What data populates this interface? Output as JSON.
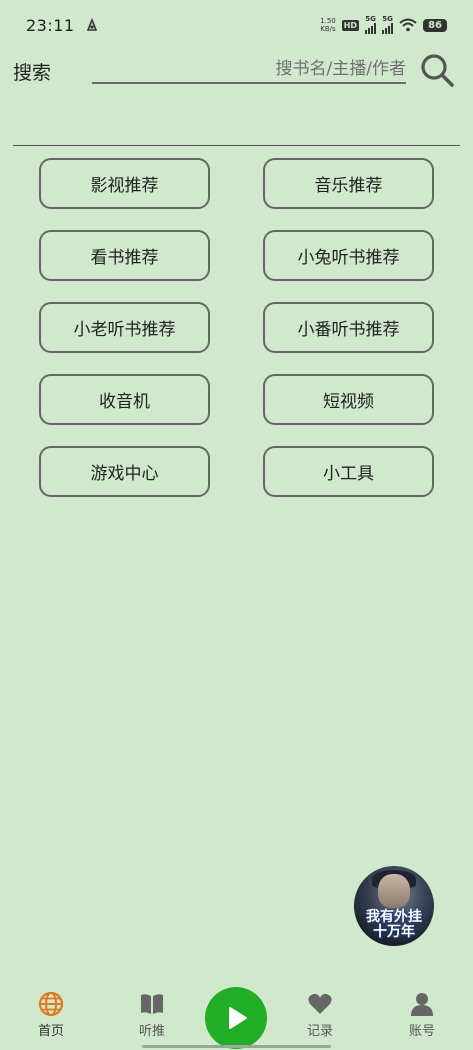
{
  "status_bar": {
    "time": "23:11",
    "net_speed_value": "1.50",
    "net_speed_unit": "KB/s",
    "hd_badge": "HD",
    "signal1_label": "5G",
    "signal2_label": "5G",
    "battery": "86"
  },
  "search": {
    "label": "搜索",
    "placeholder": "搜书名/主播/作者"
  },
  "menu": {
    "items": [
      {
        "label": "影视推荐"
      },
      {
        "label": "音乐推荐"
      },
      {
        "label": "看书推荐"
      },
      {
        "label": "小兔听书推荐"
      },
      {
        "label": "小老听书推荐"
      },
      {
        "label": "小番听书推荐"
      },
      {
        "label": "收音机"
      },
      {
        "label": "短视频"
      },
      {
        "label": "游戏中心"
      },
      {
        "label": "小工具"
      }
    ]
  },
  "floating_cover": {
    "title_line1": "我有外挂",
    "title_line2": "十万年"
  },
  "bottom_nav": {
    "home": "首页",
    "listen": "听推",
    "records": "记录",
    "account": "账号"
  },
  "colors": {
    "background": "#d0e9cc",
    "accent_play": "#1fae24",
    "home_icon": "#e07a1e"
  }
}
